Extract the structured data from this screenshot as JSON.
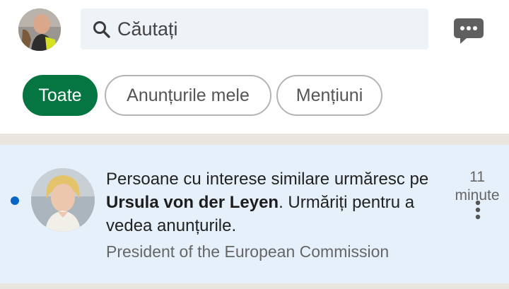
{
  "header": {
    "search": {
      "placeholder": "Căutați"
    }
  },
  "filters": [
    {
      "label": "Toate",
      "active": true
    },
    {
      "label": "Anunțurile mele",
      "active": false
    },
    {
      "label": "Mențiuni",
      "active": false
    }
  ],
  "notification": {
    "unread": true,
    "text_before": "Persoane cu interese similare urmăresc pe ",
    "name": "Ursula von der Leyen",
    "text_after": ". Urmăriți pentru a vedea anunțurile.",
    "subtitle": "President of the European Commission",
    "time_value": "11",
    "time_unit": "minute"
  },
  "colors": {
    "accent_green": "#057642",
    "unread_blue": "#0a66c2",
    "notification_bg": "#e6f0fb",
    "search_bg": "#eef3f8"
  },
  "icons": [
    "search-icon",
    "messaging-icon",
    "more-vertical-icon"
  ]
}
